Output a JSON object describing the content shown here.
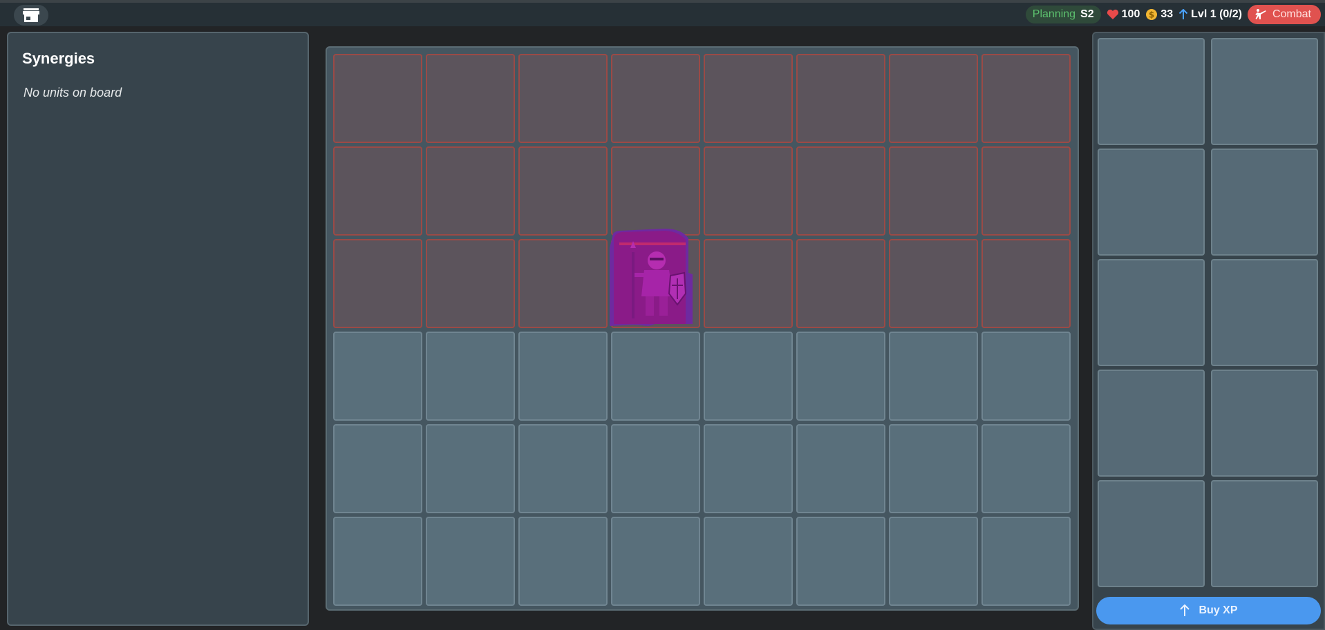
{
  "topbar": {
    "shop_icon": "store-icon",
    "phase": {
      "label": "Planning",
      "stage": "S2"
    },
    "health": {
      "icon": "heart-icon",
      "value": "100"
    },
    "gold": {
      "icon": "coin-icon",
      "value": "33"
    },
    "level": {
      "icon": "arrow-up-icon",
      "value": "Lvl 1 (0/2)"
    },
    "combat": {
      "icon": "fighter-icon",
      "label": "Combat"
    }
  },
  "synergies": {
    "title": "Synergies",
    "empty_text": "No units on board"
  },
  "board": {
    "columns": 8,
    "enemy_rows": 3,
    "ally_rows": 3,
    "units": [
      {
        "name": "knight-unit",
        "row": 3,
        "col": 4,
        "icon": "knight-icon"
      }
    ]
  },
  "bench": {
    "slots": 10,
    "buy_xp": {
      "icon": "arrow-up-icon",
      "label": "Buy XP"
    }
  },
  "colors": {
    "enemy_cell": "#5c545c",
    "enemy_border": "#9b4a46",
    "ally_cell": "#596f7b",
    "accent_blue": "#4a98ef",
    "combat_red": "#e0524f",
    "planning_green": "#5cc06e"
  }
}
